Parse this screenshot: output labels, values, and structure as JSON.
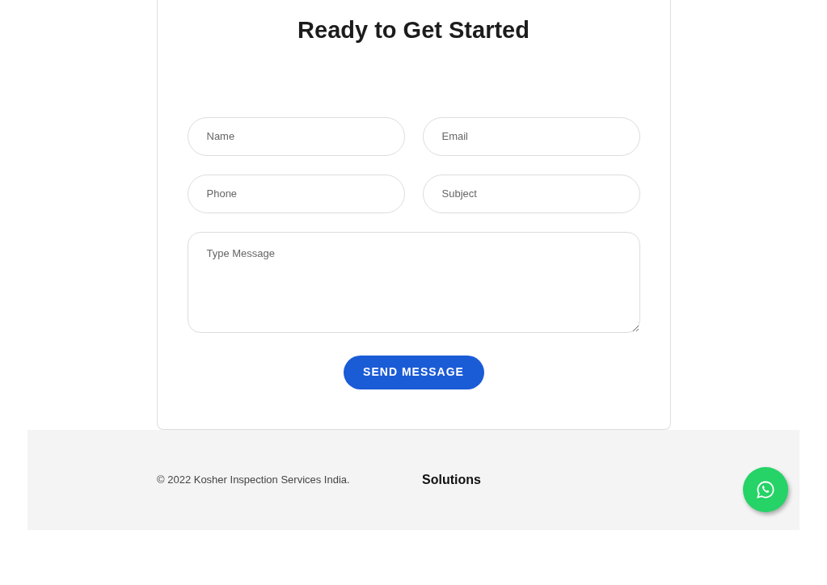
{
  "heading": "Ready to Get Started",
  "form": {
    "fields": [
      {
        "kind": "input",
        "placeholder": "Name"
      },
      {
        "kind": "input",
        "placeholder": "Email"
      },
      {
        "kind": "input",
        "placeholder": "Phone"
      },
      {
        "kind": "input",
        "placeholder": "Subject"
      },
      {
        "kind": "textarea",
        "placeholder": "Type Message"
      }
    ],
    "submit": "SEND MESSAGE"
  },
  "footer": {
    "copyright": "© 2022 Kosher Inspection Services India.",
    "column_title": "Solutions"
  }
}
